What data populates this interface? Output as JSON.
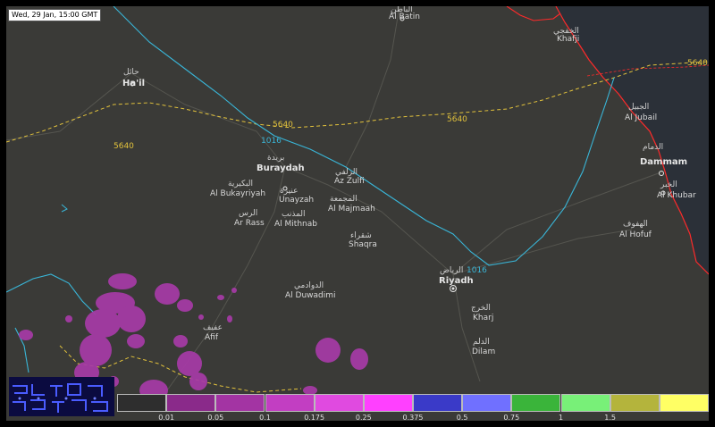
{
  "timestamp": "Wed, 29 Jan, 15:00 GMT",
  "cities": [
    {
      "ar": "الباطن",
      "en": "Al Batin"
    },
    {
      "ar": "الخفجي",
      "en": "Khafji"
    },
    {
      "ar": "حائل",
      "en": "Ha'il"
    },
    {
      "ar": "الجبيل",
      "en": "Al Jubail"
    },
    {
      "ar": "الدمام",
      "en": "Dammam"
    },
    {
      "ar": "بريدة",
      "en": "Buraydah"
    },
    {
      "ar": "الزلفي",
      "en": "Az Zulfi"
    },
    {
      "ar": "الخبر",
      "en": "Al Khubar"
    },
    {
      "ar": "البكيرية",
      "en": "Al Bukayriyah"
    },
    {
      "ar": "عنيزة",
      "en": "Unayzah"
    },
    {
      "ar": "المجمعة",
      "en": "Al Majmaah"
    },
    {
      "ar": "الرس",
      "en": "Ar Rass"
    },
    {
      "ar": "المذنب",
      "en": "Al Mithnab"
    },
    {
      "ar": "الهفوف",
      "en": "Al Hofuf"
    },
    {
      "ar": "شقراء",
      "en": "Shaqra"
    },
    {
      "ar": "الرياض",
      "en": "Riyadh"
    },
    {
      "ar": "الدوادمي",
      "en": "Al Duwadimi"
    },
    {
      "ar": "عفيف",
      "en": "Afif"
    },
    {
      "ar": "الخرج",
      "en": "Kharj"
    },
    {
      "ar": "الدلم",
      "en": "Dilam"
    }
  ],
  "contours": {
    "geopotential": [
      "5640",
      "5640",
      "5640"
    ],
    "pressure": [
      "1016",
      "1016"
    ]
  },
  "legend": {
    "colors": [
      "#2e2e2e",
      "#8a2a8a",
      "#a334a3",
      "#c23ec2",
      "#e04ae0",
      "#ff40ff",
      "#3a3ac8",
      "#7070ff",
      "#3ab43a",
      "#78f078",
      "#b4b43c",
      "#ffff64"
    ],
    "labels": [
      "0.01",
      "0.05",
      "0.1",
      "0.175",
      "0.25",
      "0.375",
      "0.5",
      "0.75",
      "1",
      "1.5"
    ]
  },
  "colors": {
    "land": "#3a3a37",
    "sea": "#2b3038",
    "pressure_isobar": "#39b6d8",
    "geopotential_contour": "#e2c23c",
    "border": "#ff2a2a",
    "precip": "#a73aa7"
  }
}
